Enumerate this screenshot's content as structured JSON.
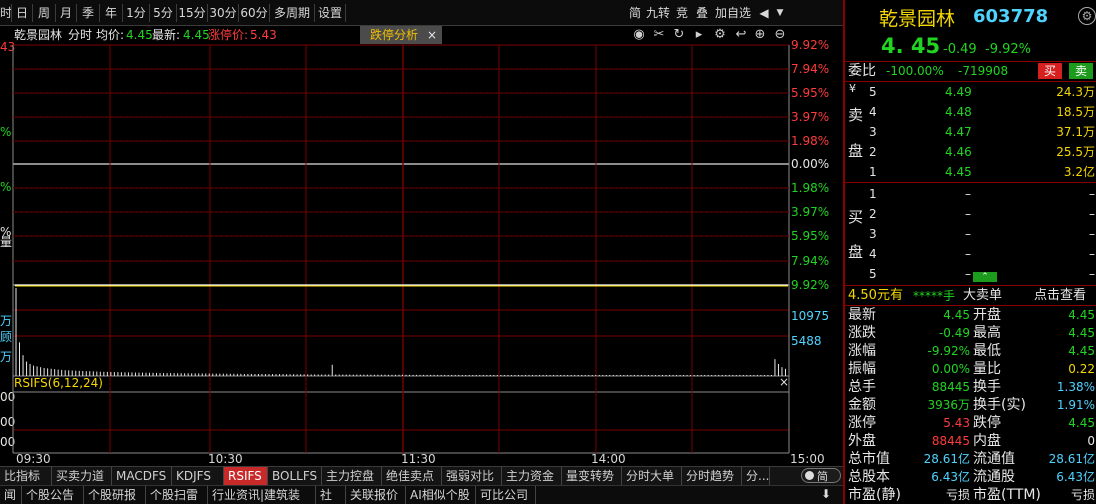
{
  "toolbar": {
    "left_items": [
      "时",
      "日",
      "周",
      "月",
      "季",
      "年",
      "1分",
      "5分",
      "15分",
      "30分",
      "60分",
      "多周期",
      "设置"
    ],
    "right_items": [
      "简",
      "九转",
      "竞",
      "叠",
      "加自选"
    ]
  },
  "info": {
    "stock_name": "乾景园林",
    "mode": "分时",
    "avg_label": "均价:",
    "avg_value": "4.45",
    "latest_label": "最新:",
    "latest_value": "4.45",
    "limit_label": "涨停价:",
    "limit_value": "5.43",
    "analysis_tab": "跌停分析",
    "close_glyph": "×"
  },
  "left_edge": {
    "labels": [
      "43",
      "%",
      "%",
      "%",
      "量",
      "万",
      "顾",
      "万",
      "00",
      "00",
      "00"
    ]
  },
  "price_axis": [
    "9.92%",
    "7.94%",
    "5.95%",
    "3.97%",
    "1.98%",
    "0.00%",
    "1.98%",
    "3.97%",
    "5.95%",
    "7.94%",
    "9.92%"
  ],
  "volume_axis": [
    "10975",
    "5488"
  ],
  "indicator": {
    "label": "RSIFS(6,12,24)"
  },
  "time_axis": [
    "09:30",
    "10:30",
    "11:30",
    "14:00",
    "15:00"
  ],
  "chart_data": {
    "type": "line",
    "title": "乾景园林 分时",
    "price_series": {
      "name": "最新",
      "value": 4.45,
      "change_pct": -9.92
    },
    "volume_series": {
      "name": "成交量",
      "values": [
        10975,
        4200,
        2600,
        1800,
        1500,
        1300,
        1200,
        1100,
        1000,
        950,
        900,
        850,
        800,
        760,
        720,
        700,
        680,
        660,
        640,
        620,
        600,
        600,
        580,
        560,
        540,
        520,
        510,
        500,
        490,
        480,
        470,
        460,
        450,
        440,
        430,
        420,
        420,
        410,
        400,
        400,
        390,
        380,
        380,
        370,
        360,
        360,
        350,
        350,
        340,
        340,
        330,
        330,
        320,
        320,
        310,
        310,
        300,
        300,
        290,
        290,
        280,
        280,
        280,
        270,
        270,
        260,
        260,
        260,
        250,
        250,
        250,
        240,
        240,
        240,
        230,
        230,
        230,
        220,
        220,
        220,
        210,
        210,
        210,
        200,
        200,
        200,
        200,
        190,
        190,
        190,
        1400,
        190,
        180,
        180,
        180,
        180,
        170,
        170,
        170,
        170,
        170,
        160,
        160,
        160,
        160,
        160,
        150,
        150,
        150,
        150,
        150,
        150,
        140,
        140,
        140,
        140,
        140,
        140,
        140,
        130,
        130,
        130,
        130,
        130,
        130,
        130,
        130,
        120,
        120,
        120,
        120,
        120,
        120,
        120,
        120,
        120,
        110,
        110,
        110,
        110,
        110,
        110,
        110,
        110,
        110,
        110,
        100,
        100,
        100,
        100,
        100,
        100,
        100,
        100,
        100,
        100,
        100,
        100,
        100,
        100,
        100,
        100,
        100,
        100,
        100,
        100,
        100,
        100,
        100,
        100,
        100,
        100,
        100,
        100,
        100,
        100,
        100,
        100,
        100,
        100,
        100,
        100,
        100,
        100,
        100,
        100,
        100,
        100,
        100,
        100,
        100,
        100,
        100,
        100,
        100,
        100,
        100,
        100,
        100,
        100,
        100,
        100,
        100,
        100,
        100,
        100,
        100,
        100,
        100,
        100,
        100,
        100,
        100,
        100,
        100,
        100,
        2100,
        1500,
        1100,
        900
      ]
    },
    "ylim_pct": [
      -9.92,
      9.92
    ],
    "volume_max": 10975
  },
  "bottom_tabs": [
    "比指标",
    "买卖力道",
    "MACDFS",
    "KDJFS",
    "RSIFS",
    "BOLLFS",
    "主力控盘",
    "绝佳卖点",
    "强弱对比",
    "主力资金",
    "量变转势",
    "分时大单",
    "分时趋势",
    "分..."
  ],
  "bottom_active": "RSIFS",
  "bottom2": [
    "闻",
    "个股公告",
    "个股研报",
    "个股扫雷",
    "行业资讯|建筑装饰",
    "社区",
    "关联报价",
    "AI相似个股",
    "可比公司"
  ],
  "right": {
    "name": "乾景园林",
    "code": "603778",
    "price": "4. 45",
    "change": "-0.49",
    "change_pct": "-9.92%",
    "weibi_label": "委比",
    "weibi_pct": "-100.00%",
    "weibi_val": "-719908",
    "sell_btn": "买",
    "buy_btn": "卖",
    "sell_side_label": [
      "卖",
      "盘"
    ],
    "buy_side_label": [
      "买",
      "盘"
    ],
    "sells": [
      {
        "n": "5",
        "p": "4.49",
        "v": "24.3万"
      },
      {
        "n": "4",
        "p": "4.48",
        "v": "18.5万"
      },
      {
        "n": "3",
        "p": "4.47",
        "v": "37.1万"
      },
      {
        "n": "2",
        "p": "4.46",
        "v": "25.5万"
      },
      {
        "n": "1",
        "p": "4.45",
        "v": "3.2亿"
      }
    ],
    "buys": [
      {
        "n": "1",
        "p": "–",
        "v": "–"
      },
      {
        "n": "2",
        "p": "–",
        "v": "–"
      },
      {
        "n": "3",
        "p": "–",
        "v": "–"
      },
      {
        "n": "4",
        "p": "–",
        "v": "–"
      },
      {
        "n": "5",
        "p": "–",
        "v": "–"
      }
    ],
    "big_order": {
      "price": "4.50元有",
      "hands": "*****手",
      "label": "大卖单",
      "link": "点击查看"
    },
    "stats": [
      [
        "最新",
        "4.45",
        "开盘",
        "4.45"
      ],
      [
        "涨跌",
        "-0.49",
        "最高",
        "4.45"
      ],
      [
        "涨幅",
        "-9.92%",
        "最低",
        "4.45"
      ],
      [
        "振幅",
        "0.00%",
        "量比",
        "0.22"
      ],
      [
        "总手",
        "88445",
        "换手",
        "1.38%"
      ],
      [
        "金额",
        "3936万",
        "换手(实)",
        "1.91%"
      ],
      [
        "涨停",
        "5.43",
        "跌停",
        "4.45"
      ],
      [
        "外盘",
        "88445",
        "内盘",
        "0"
      ],
      [
        "总市值",
        "28.61亿",
        "流通值",
        "28.61亿"
      ],
      [
        "总股本",
        "6.43亿",
        "流通股",
        "6.43亿"
      ],
      [
        "市盈(静)",
        "亏损",
        "市盈(TTM)",
        "亏损"
      ]
    ]
  },
  "colors": {
    "red": "#ff3b3b",
    "green": "#22d422",
    "grid": "#7a0000",
    "yellow": "#f5d800",
    "cyan": "#4fd3ff"
  }
}
